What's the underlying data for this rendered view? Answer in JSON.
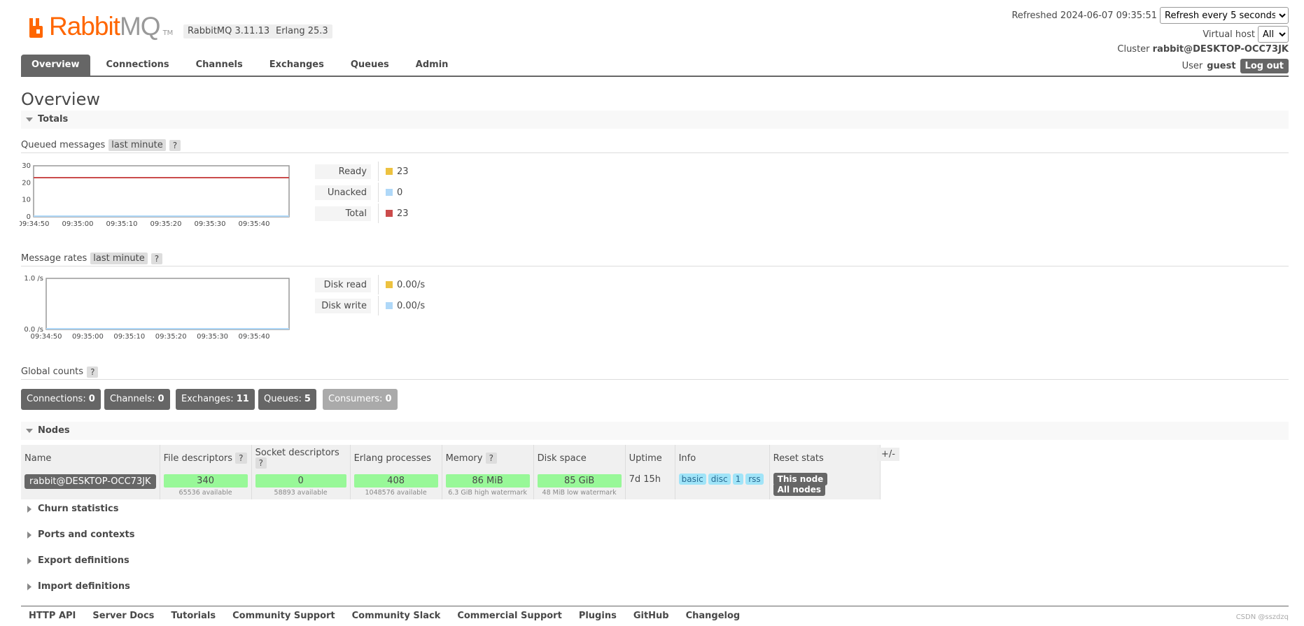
{
  "header": {
    "brand_main": "Rabbit",
    "brand_sub": "MQ",
    "brand_tm": "TM",
    "rabbitmq_version": "RabbitMQ 3.11.13",
    "erlang_version": "Erlang 25.3",
    "refreshed_label": "Refreshed 2024-06-07 09:35:51",
    "refresh_select": "Refresh every 5 seconds",
    "vhost_label": "Virtual host",
    "vhost_select": "All",
    "cluster_label": "Cluster",
    "cluster_name": "rabbit@DESKTOP-OCC73JK",
    "user_label": "User",
    "user_name": "guest",
    "logout_label": "Log out"
  },
  "tabs": [
    {
      "label": "Overview",
      "active": true
    },
    {
      "label": "Connections",
      "active": false
    },
    {
      "label": "Channels",
      "active": false
    },
    {
      "label": "Exchanges",
      "active": false
    },
    {
      "label": "Queues",
      "active": false
    },
    {
      "label": "Admin",
      "active": false
    }
  ],
  "page_title": "Overview",
  "totals": {
    "heading": "Totals",
    "queued": {
      "label": "Queued messages",
      "period": "last minute",
      "help": "?",
      "legend": [
        {
          "label": "Ready",
          "value": "23",
          "color": "#edc240"
        },
        {
          "label": "Unacked",
          "value": "0",
          "color": "#afd8f8"
        },
        {
          "label": "Total",
          "value": "23",
          "color": "#cb4b4b"
        }
      ]
    },
    "rates": {
      "label": "Message rates",
      "period": "last minute",
      "help": "?",
      "legend": [
        {
          "label": "Disk read",
          "value": "0.00/s",
          "color": "#edc240"
        },
        {
          "label": "Disk write",
          "value": "0.00/s",
          "color": "#afd8f8"
        }
      ]
    },
    "global_counts": {
      "label": "Global counts",
      "help": "?",
      "items": [
        {
          "label": "Connections:",
          "value": "0"
        },
        {
          "label": "Channels:",
          "value": "0"
        },
        {
          "label": "Exchanges:",
          "value": "11"
        },
        {
          "label": "Queues:",
          "value": "5"
        },
        {
          "label": "Consumers:",
          "value": "0"
        }
      ]
    }
  },
  "chart_data": [
    {
      "type": "line",
      "title": "Queued messages",
      "x": [
        "09:34:50",
        "09:35:00",
        "09:35:10",
        "09:35:20",
        "09:35:30",
        "09:35:40"
      ],
      "ylim": [
        0,
        30
      ],
      "y_ticks": [
        "0",
        "10",
        "20",
        "30"
      ],
      "series": [
        {
          "name": "Ready",
          "values": [
            23,
            23,
            23,
            23,
            23,
            23
          ],
          "color": "#edc240"
        },
        {
          "name": "Unacked",
          "values": [
            0,
            0,
            0,
            0,
            0,
            0
          ],
          "color": "#afd8f8"
        },
        {
          "name": "Total",
          "values": [
            23,
            23,
            23,
            23,
            23,
            23
          ],
          "color": "#cb4b4b"
        }
      ]
    },
    {
      "type": "line",
      "title": "Message rates",
      "x": [
        "09:34:50",
        "09:35:00",
        "09:35:10",
        "09:35:20",
        "09:35:30",
        "09:35:40"
      ],
      "ylim": [
        0,
        1
      ],
      "y_ticks": [
        "0.0 /s",
        "1.0 /s"
      ],
      "series": [
        {
          "name": "Disk read",
          "values": [
            0,
            0,
            0,
            0,
            0,
            0
          ],
          "color": "#edc240"
        },
        {
          "name": "Disk write",
          "values": [
            0,
            0,
            0,
            0,
            0,
            0
          ],
          "color": "#afd8f8"
        }
      ]
    }
  ],
  "nodes": {
    "heading": "Nodes",
    "columns": [
      "Name",
      "File descriptors",
      "Socket descriptors",
      "Erlang processes",
      "Memory",
      "Disk space",
      "Uptime",
      "Info",
      "Reset stats"
    ],
    "column_help": "?",
    "plus_minus": "+/-",
    "row": {
      "name": "rabbit@DESKTOP-OCC73JK",
      "file_descriptors": "340",
      "file_descriptors_sub": "65536 available",
      "socket_descriptors": "0",
      "socket_descriptors_sub": "58893 available",
      "erlang_processes": "408",
      "erlang_processes_sub": "1048576 available",
      "memory": "86 MiB",
      "memory_sub": "6.3 GiB high watermark",
      "disk_space": "85 GiB",
      "disk_space_sub": "48 MiB low watermark",
      "uptime": "7d 15h",
      "info_tags": [
        "basic",
        "disc",
        "1",
        "rss"
      ],
      "reset_this": "This node",
      "reset_all": "All nodes"
    }
  },
  "collapsed_sections": [
    "Churn statistics",
    "Ports and contexts",
    "Export definitions",
    "Import definitions"
  ],
  "footer": {
    "links": [
      "HTTP API",
      "Server Docs",
      "Tutorials",
      "Community Support",
      "Community Slack",
      "Commercial Support",
      "Plugins",
      "GitHub",
      "Changelog"
    ],
    "watermark": "CSDN @sszdzq"
  }
}
